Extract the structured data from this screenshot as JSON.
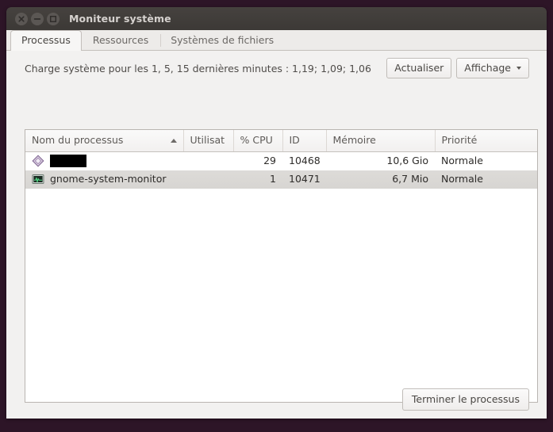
{
  "window": {
    "title": "Moniteur système",
    "controls": [
      {
        "name": "close",
        "glyph": "×"
      },
      {
        "name": "minimize",
        "glyph": "–"
      },
      {
        "name": "maximize",
        "glyph": "□"
      }
    ]
  },
  "tabs": [
    {
      "label": "Processus",
      "active": true
    },
    {
      "label": "Ressources",
      "active": false
    },
    {
      "label": "Systèmes de fichiers",
      "active": false
    }
  ],
  "toolbar": {
    "load_average": "Charge système pour les 1, 5, 15 dernières minutes : 1,19; 1,09; 1,06",
    "refresh_label": "Actualiser",
    "view_label": "Affichage"
  },
  "table": {
    "columns": [
      {
        "label": "Nom du processus",
        "align": "left",
        "sorted": true
      },
      {
        "label": "Utilisat",
        "align": "left",
        "sorted": false
      },
      {
        "label": "% CPU",
        "align": "left",
        "sorted": false
      },
      {
        "label": "ID",
        "align": "left",
        "sorted": false
      },
      {
        "label": "Mémoire",
        "align": "left",
        "sorted": false
      },
      {
        "label": "Priorité",
        "align": "left",
        "sorted": false
      }
    ],
    "rows": [
      {
        "name": "",
        "redacted": true,
        "icon": "diamond-app-icon",
        "user": "",
        "cpu": "29",
        "id": "10468",
        "memory": "10,6 Gio",
        "priority": "Normale",
        "selected": false
      },
      {
        "name": "gnome-system-monitor",
        "redacted": false,
        "icon": "system-monitor-icon",
        "user": "",
        "cpu": "1",
        "id": "10471",
        "memory": "6,7 Mio",
        "priority": "Normale",
        "selected": true
      }
    ]
  },
  "footer": {
    "end_process_label": "Terminer le processus"
  },
  "colors": {
    "desktop": "#2d1527",
    "titlebar": "#403d3a",
    "content": "#f2f1f0",
    "selection": "#dddbd8",
    "text": "#2e2c2a"
  }
}
